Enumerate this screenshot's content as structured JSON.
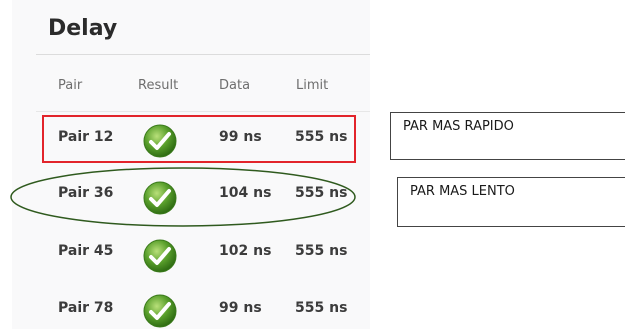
{
  "title": "Delay",
  "columns": {
    "pair": "Pair",
    "result": "Result",
    "data": "Data",
    "limit": "Limit"
  },
  "rows": [
    {
      "pair": "Pair 12",
      "result": "check-icon",
      "data": "99 ns",
      "limit": "555 ns"
    },
    {
      "pair": "Pair 36",
      "result": "check-icon",
      "data": "104 ns",
      "limit": "555 ns"
    },
    {
      "pair": "Pair 45",
      "result": "check-icon",
      "data": "102 ns",
      "limit": "555 ns"
    },
    {
      "pair": "Pair 78",
      "result": "check-icon",
      "data": "99 ns",
      "limit": "555 ns"
    }
  ],
  "annotations": {
    "fastest_label": "PAR MAS RAPIDO",
    "slowest_label": "PAR MAS LENTO"
  },
  "colors": {
    "highlight_fastest": "#e2242b",
    "highlight_slowest": "#2f5a1e",
    "check_green": "#5aa02c"
  }
}
